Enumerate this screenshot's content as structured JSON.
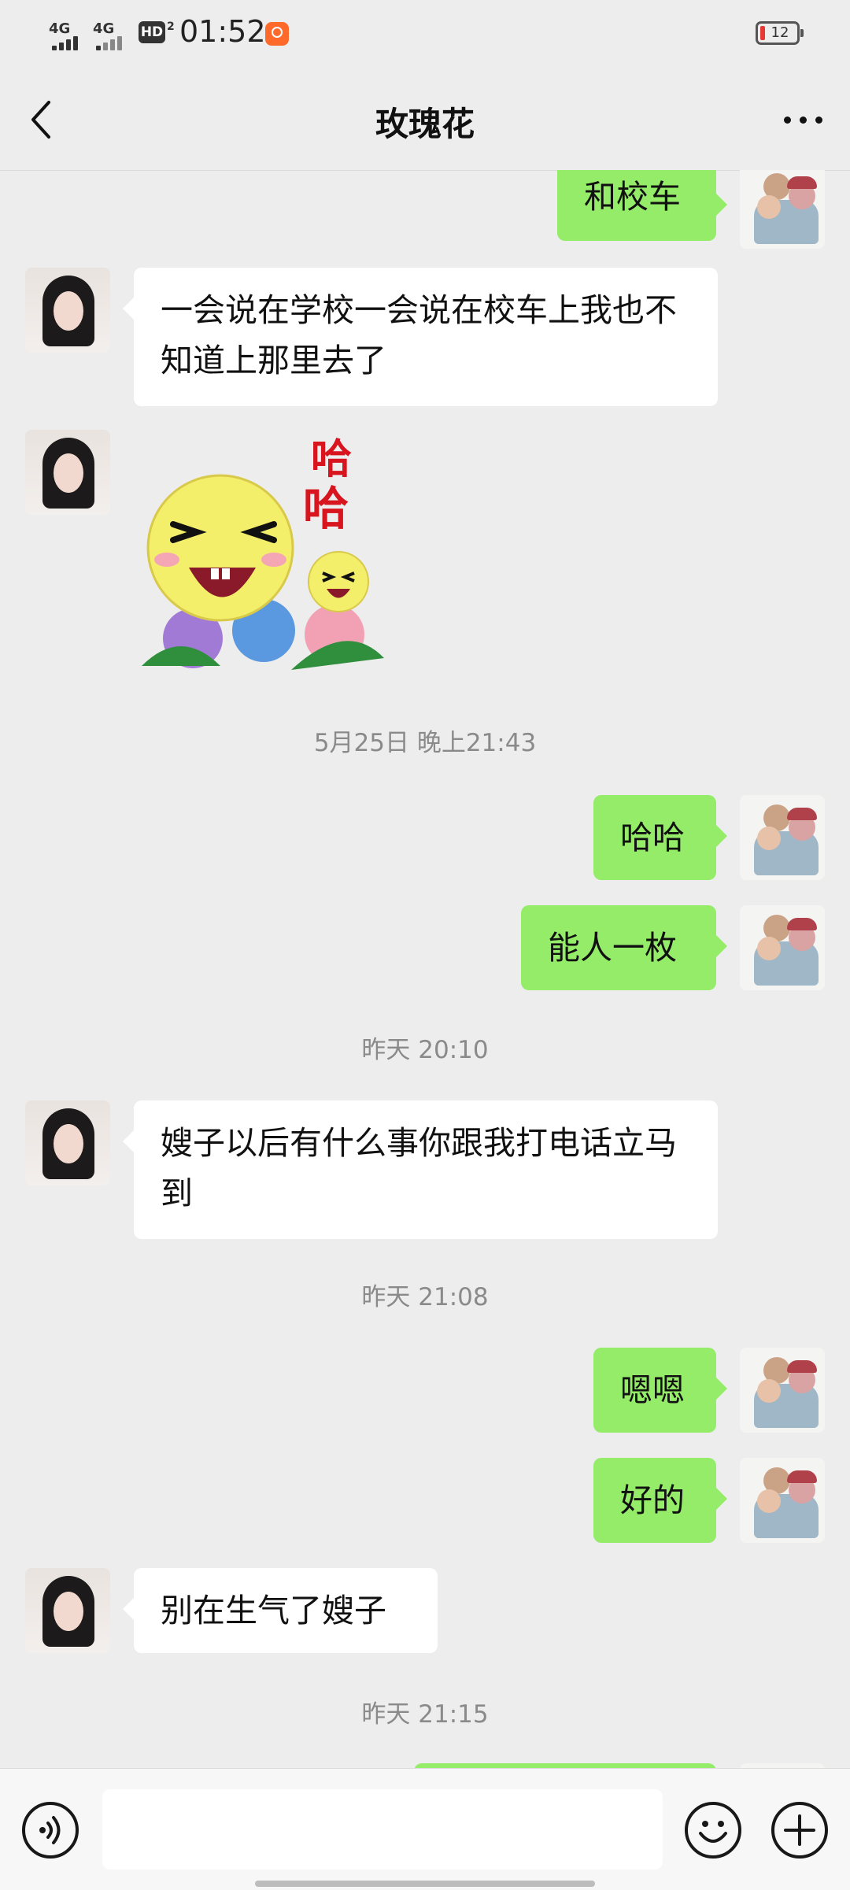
{
  "status_bar": {
    "network_1": "4G",
    "network_2": "4G",
    "hd": "HD",
    "hd_sub": "2",
    "time": "01:52",
    "battery": "12"
  },
  "nav": {
    "title": "玫瑰花"
  },
  "messages": {
    "m1": "和校车",
    "m2": "一会说在学校一会说在校车上我也不知道上那里去了",
    "t1": "5月25日 晚上21:43",
    "m3": "哈哈",
    "m4": "能人一枚",
    "t2": "昨天 20:10",
    "m5": "嫂子以后有什么事你跟我打电话立马到",
    "t3": "昨天 21:08",
    "m6": "嗯嗯",
    "m7": "好的",
    "m8": "别在生气了嫂子",
    "t4": "昨天 21:15"
  },
  "sticker": {
    "text_1": "哈",
    "text_2": "哈"
  },
  "colors": {
    "background": "#ededed",
    "outgoing_bubble": "#95ec69",
    "incoming_bubble": "#ffffff"
  }
}
